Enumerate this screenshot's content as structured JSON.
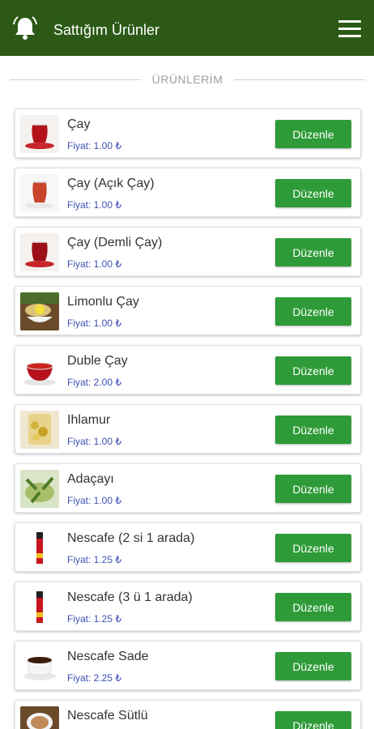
{
  "app": {
    "title": "Sattığım Ürünler"
  },
  "section_title": "ÜRÜNLERİM",
  "colors": {
    "appbar": "#2c5a16",
    "button": "#2e9b38",
    "price": "#3f51b5"
  },
  "products": [
    {
      "name": "Çay",
      "price": "Fiyat: 1.00 ₺",
      "button": "Düzenle",
      "icon": "tea-glass"
    },
    {
      "name": "Çay (Açık Çay)",
      "price": "Fiyat: 1.00 ₺",
      "button": "Düzenle",
      "icon": "light-tea-glass"
    },
    {
      "name": "Çay (Demli Çay)",
      "price": "Fiyat: 1.00 ₺",
      "button": "Düzenle",
      "icon": "strong-tea-glass"
    },
    {
      "name": "Limonlu Çay",
      "price": "Fiyat: 1.00 ₺",
      "button": "Düzenle",
      "icon": "lemon-tea"
    },
    {
      "name": "Duble Çay",
      "price": "Fiyat: 2.00 ₺",
      "button": "Düzenle",
      "icon": "double-tea-cup"
    },
    {
      "name": "Ihlamur",
      "price": "Fiyat: 1.00 ₺",
      "button": "Düzenle",
      "icon": "linden-tea"
    },
    {
      "name": "Adaçayı",
      "price": "Fiyat: 1.00 ₺",
      "button": "Düzenle",
      "icon": "sage-tea"
    },
    {
      "name": "Nescafe (2 si 1 arada)",
      "price": "Fiyat: 1.25 ₺",
      "button": "Düzenle",
      "icon": "nescafe-stick"
    },
    {
      "name": "Nescafe (3 ü 1 arada)",
      "price": "Fiyat: 1.25 ₺",
      "button": "Düzenle",
      "icon": "nescafe-stick"
    },
    {
      "name": "Nescafe Sade",
      "price": "Fiyat: 2.25 ₺",
      "button": "Düzenle",
      "icon": "black-coffee-cup"
    },
    {
      "name": "Nescafe Sütlü",
      "price": "",
      "button": "Düzenle",
      "icon": "milk-coffee-cup"
    }
  ]
}
